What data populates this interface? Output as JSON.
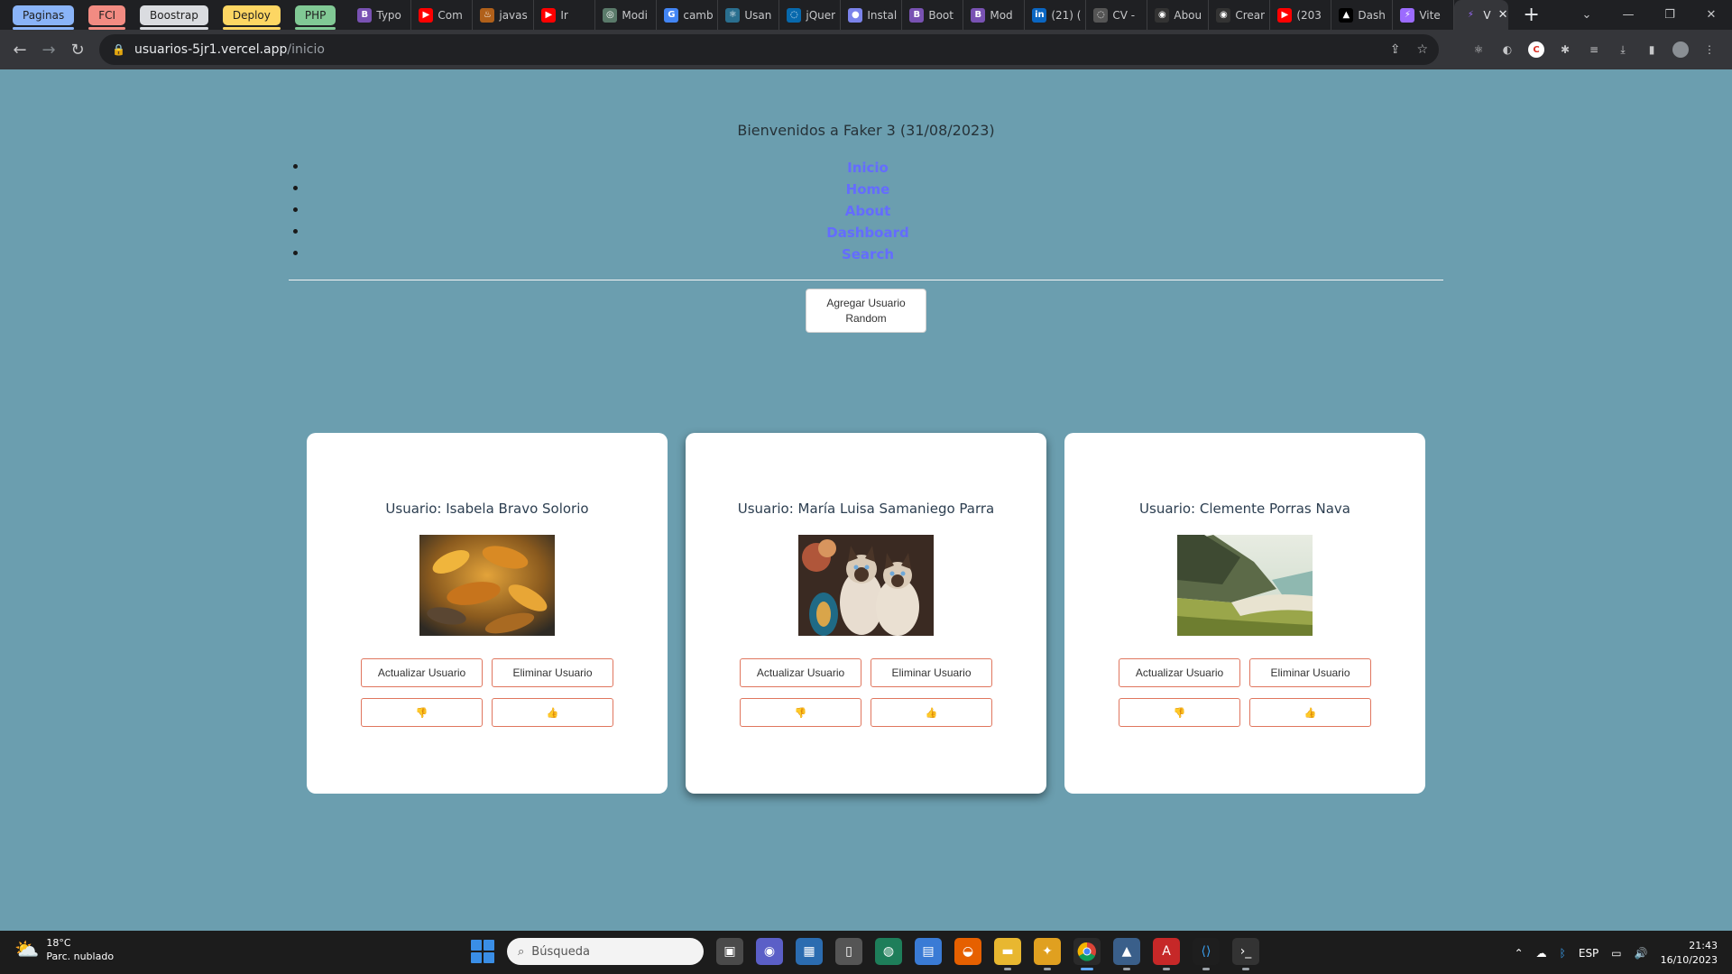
{
  "browser": {
    "tab_groups": [
      {
        "label": "Paginas",
        "color": "#8ab4f8"
      },
      {
        "label": "FCI",
        "color": "#f28b82"
      },
      {
        "label": "Boostrap",
        "color": "#dadce0"
      },
      {
        "label": "Deploy",
        "color": "#fdd663"
      },
      {
        "label": "PHP",
        "color": "#81c995"
      }
    ],
    "tabs": [
      {
        "label": "Typo",
        "icon": "B",
        "color": "#7952b3"
      },
      {
        "label": "Com",
        "icon": "▶",
        "color": "#ff0000"
      },
      {
        "label": "javas",
        "icon": "♨",
        "color": "#b0601a"
      },
      {
        "label": "Ir",
        "icon": "▶",
        "color": "#ff0000"
      },
      {
        "label": "Modi",
        "icon": "◎",
        "color": "#5a7a6a"
      },
      {
        "label": "camb",
        "icon": "G",
        "color": "#4285f4"
      },
      {
        "label": "Usan",
        "icon": "⚛",
        "color": "#2a6f8f"
      },
      {
        "label": "jQuer",
        "icon": "◌",
        "color": "#0769ad"
      },
      {
        "label": "Instal",
        "icon": "●",
        "color": "#7b83eb"
      },
      {
        "label": "Boot",
        "icon": "B",
        "color": "#7952b3"
      },
      {
        "label": "Mod",
        "icon": "B",
        "color": "#7952b3"
      },
      {
        "label": "(21) (",
        "icon": "in",
        "color": "#0a66c2"
      },
      {
        "label": "CV -",
        "icon": "◌",
        "color": "#555"
      },
      {
        "label": "Abou",
        "icon": "◉",
        "color": "#333"
      },
      {
        "label": "Crear",
        "icon": "◉",
        "color": "#333"
      },
      {
        "label": "(203",
        "icon": "▶",
        "color": "#ff0000"
      },
      {
        "label": "Dash",
        "icon": "▲",
        "color": "#000"
      },
      {
        "label": "Vite",
        "icon": "⚡",
        "color": "#9c6bff"
      }
    ],
    "active_tab": {
      "label": "V",
      "icon": "⚡"
    },
    "window_controls": {
      "dropdown": "⌄",
      "minimize": "—",
      "restore": "❐",
      "close": "✕"
    },
    "url_host": "usuarios-5jr1.vercel.app",
    "url_path": "/inicio"
  },
  "page": {
    "welcome": "Bienvenidos a Faker 3 (31/08/2023)",
    "nav": [
      "Inicio",
      "Home",
      "About",
      "Dashboard",
      "Search"
    ],
    "add_button": "Agregar Usuario Random",
    "accent": "#646cff",
    "users": [
      {
        "name": "Usuario: Isabela Bravo Solorio",
        "image": "autumn-leaves",
        "update_label": "Actualizar Usuario",
        "delete_label": "Eliminar Usuario",
        "dislike": "👎",
        "like": "👍"
      },
      {
        "name": "Usuario: María Luisa Samaniego Parra",
        "image": "siamese-cats",
        "update_label": "Actualizar Usuario",
        "delete_label": "Eliminar Usuario",
        "dislike": "👎",
        "like": "👍"
      },
      {
        "name": "Usuario: Clemente Porras Nava",
        "image": "coastal-mountain",
        "update_label": "Actualizar Usuario",
        "delete_label": "Eliminar Usuario",
        "dislike": "👎",
        "like": "👍"
      }
    ]
  },
  "taskbar": {
    "temperature": "18°C",
    "weather": "Parc. nublado",
    "search_placeholder": "Búsqueda",
    "lang": "ESP",
    "time": "21:43",
    "date": "16/10/2023"
  }
}
